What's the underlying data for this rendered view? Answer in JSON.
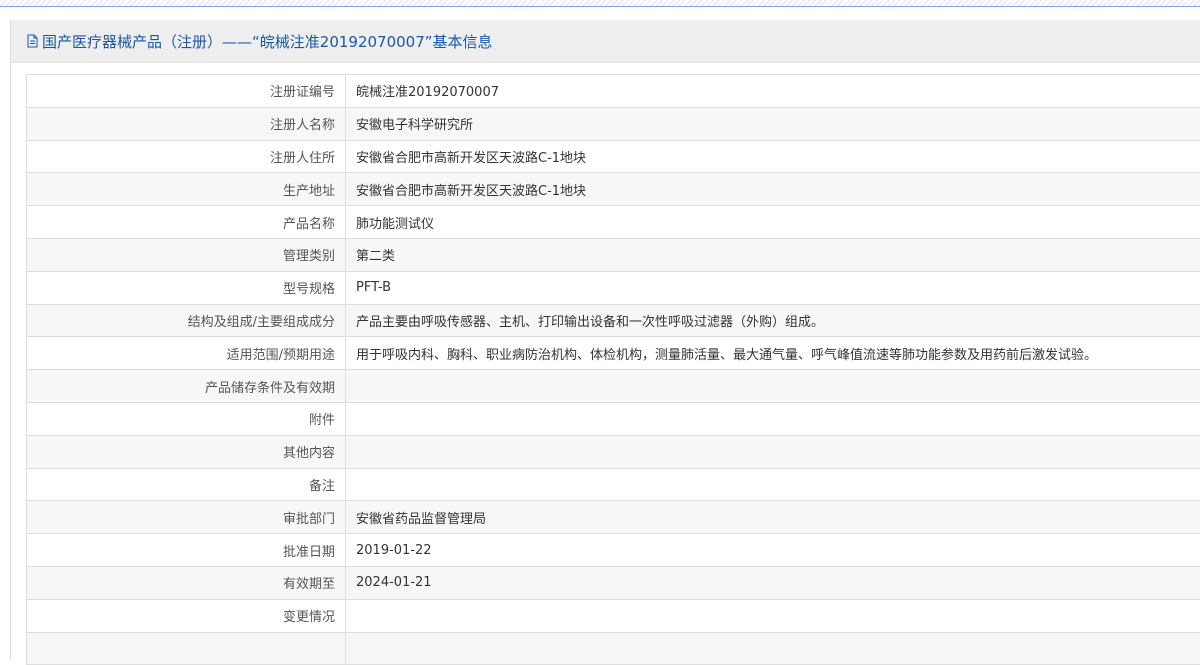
{
  "header": {
    "title": "国产医疗器械产品（注册）——“皖械注准20192070007”基本信息"
  },
  "rows": [
    {
      "label": "注册证编号",
      "value": "皖械注准20192070007"
    },
    {
      "label": "注册人名称",
      "value": "安徽电子科学研究所"
    },
    {
      "label": "注册人住所",
      "value": "安徽省合肥市高新开发区天波路C-1地块"
    },
    {
      "label": "生产地址",
      "value": "安徽省合肥市高新开发区天波路C-1地块"
    },
    {
      "label": "产品名称",
      "value": "肺功能测试仪"
    },
    {
      "label": "管理类别",
      "value": "第二类"
    },
    {
      "label": "型号规格",
      "value": "PFT-B"
    },
    {
      "label": "结构及组成/主要组成成分",
      "value": "产品主要由呼吸传感器、主机、打印输出设备和一次性呼吸过滤器（外购）组成。"
    },
    {
      "label": "适用范围/预期用途",
      "value": "用于呼吸内科、胸科、职业病防治机构、体检机构，测量肺活量、最大通气量、呼气峰值流速等肺功能参数及用药前后激发试验。"
    },
    {
      "label": "产品储存条件及有效期",
      "value": ""
    },
    {
      "label": "附件",
      "value": ""
    },
    {
      "label": "其他内容",
      "value": ""
    },
    {
      "label": "备注",
      "value": ""
    },
    {
      "label": "审批部门",
      "value": "安徽省药品监督管理局"
    },
    {
      "label": "批准日期",
      "value": "2019-01-22"
    },
    {
      "label": "有效期至",
      "value": "2024-01-21"
    },
    {
      "label": "变更情况",
      "value": ""
    },
    {
      "label": "",
      "value": ""
    }
  ]
}
